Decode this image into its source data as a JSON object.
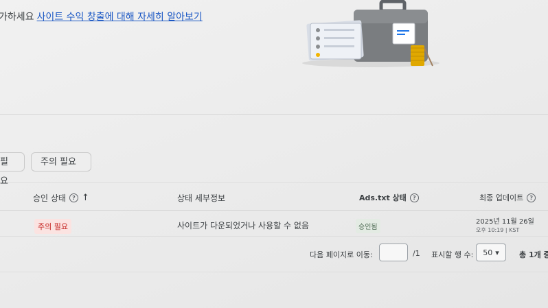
{
  "intro": {
    "text": "가하세요",
    "link": "사이트 수익 창출에 대해 자세히 알아보기"
  },
  "filters": [
    {
      "label": "필요"
    },
    {
      "label": "주의 필요"
    }
  ],
  "table": {
    "columns": {
      "approval_status": "승인 상태",
      "status_details": "상태 세부정보",
      "ads_txt_status": "Ads.txt 상태",
      "last_updated": "최종 업데이트"
    },
    "rows": [
      {
        "approval_status": "주의 필요",
        "status_details": "사이트가 다운되었거나 사용할 수 없음",
        "ads_txt_status": "승인됨",
        "date": "2025년 11월 26일",
        "time": "오후 10:19 | KST"
      }
    ]
  },
  "pagination": {
    "goto_label": "다음 페이지로 이동:",
    "page_input_value": "",
    "total_pages": "/1",
    "rows_label": "표시할 행 수:",
    "rows_value": "50",
    "total_count": "총 1개 중"
  },
  "colors": {
    "link": "#1a57c4",
    "warn_bg": "#fbe3e1",
    "warn_text": "#c5221f",
    "ok_bg": "#e3ebe3",
    "ok_text": "#4d6b53"
  },
  "icons": {
    "sort": "arrow-up-icon",
    "help": "help-circle-icon",
    "dropdown": "caret-down-icon",
    "illustration": "briefcase-illustration"
  }
}
